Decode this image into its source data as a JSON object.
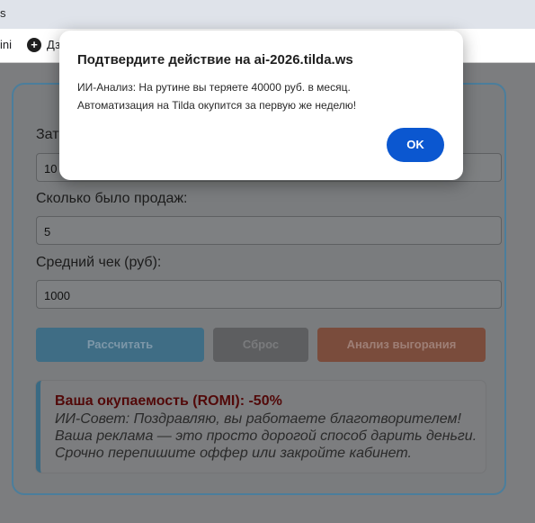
{
  "browser": {
    "tab_fragment": "s",
    "bookmark_left_fragment": "ini",
    "bookmark_icon_glyph": "+",
    "bookmark_fragment": "Дз"
  },
  "form": {
    "field1_label_fragment": "Зат",
    "field1_value_fragment": "10",
    "field2_label": "Сколько было продаж:",
    "field2_value": "5",
    "field3_label": "Средний чек (руб):",
    "field3_value": "1000"
  },
  "buttons": {
    "calc": "Рассчитать",
    "reset": "Сброс",
    "burnout": "Анализ выгорания"
  },
  "result": {
    "title": "Ваша окупаемость (ROMI): -50%",
    "advice": "ИИ-Совет: Поздравляю, вы работаете благотворителем! Ваша реклама — это просто дорогой способ дарить деньги. Срочно перепишите оффер или закройте кабинет."
  },
  "dialog": {
    "title": "Подтвердите действие на ai-2026.tilda.ws",
    "message_line1": "ИИ-Анализ: На рутине вы теряете 40000 руб. в месяц.",
    "message_line2": "Автоматизация на Tilda окупится за первую же неделю!",
    "ok_label": "OK"
  },
  "colors": {
    "primary": "#0b57d0",
    "calc_button": "#3f6d85",
    "burnout_button": "#7a4c3c",
    "result_title": "#520909"
  }
}
